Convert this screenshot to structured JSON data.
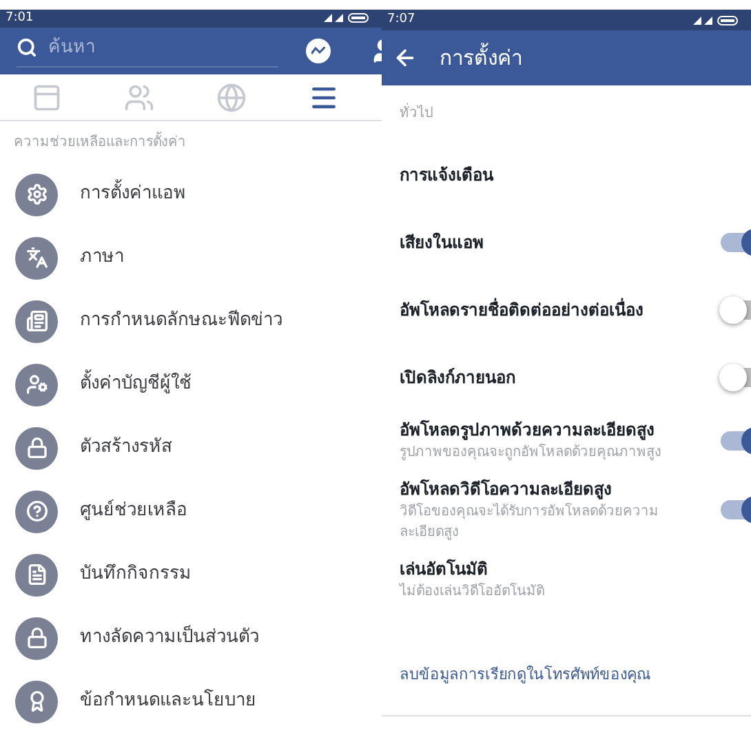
{
  "left_screen": {
    "status_bar": {
      "time": "7:01"
    },
    "search": {
      "placeholder": "ค้นหา"
    },
    "tabs": [
      {
        "selected": false
      },
      {
        "selected": false
      },
      {
        "selected": false
      },
      {
        "selected": true
      }
    ],
    "section": "ความช่วยเหลือและการตั้งค่า",
    "items": [
      {
        "label": "การตั้งค่าแอพ"
      },
      {
        "label": "ภาษา"
      },
      {
        "label": "การกำหนดลักษณะฟีดข่าว"
      },
      {
        "label": "ตั้งค่าบัญชีผู้ใช้"
      },
      {
        "label": "ตัวสร้างรหัส"
      },
      {
        "label": "ศูนย์ช่วยเหลือ"
      },
      {
        "label": "บันทึกกิจกรรม"
      },
      {
        "label": "ทางลัดความเป็นส่วนตัว"
      },
      {
        "label": "ข้อกำหนดและนโยบาย"
      }
    ]
  },
  "right_screen": {
    "status_bar": {
      "time": "7:07"
    },
    "title": "การตั้งค่า",
    "section": "ทั่วไป",
    "rows": [
      {
        "kind": "plain",
        "title": "การแจ้งเตือน"
      },
      {
        "kind": "toggle",
        "title": "เสียงในแอพ",
        "on": true
      },
      {
        "kind": "toggle",
        "title": "อัพโหลดรายชื่อติดต่ออย่างต่อเนื่อง",
        "on": false
      },
      {
        "kind": "toggle",
        "title": "เปิดลิงก์ภายนอก",
        "on": false
      },
      {
        "kind": "toggle",
        "title": "อัพโหลดรูปภาพด้วยความละเอียดสูง",
        "subtitle": "รูปภาพของคุณจะถูกอัพโหลดด้วยคุณภาพสูง",
        "on": true
      },
      {
        "kind": "toggle",
        "title": "อัพโหลดวิดีโอความละเอียดสูง",
        "subtitle": "วิดีโอของคุณจะได้รับการอัพโหลดด้วยความละเอียดสูง",
        "on": true
      },
      {
        "kind": "plain",
        "title": "เล่นอัตโนมัติ",
        "subtitle": "ไม่ต้องเล่นวิดีโออัตโนมัติ"
      },
      {
        "kind": "link",
        "title": "ลบข้อมูลการเรียกดูในโทรศัพท์ของคุณ"
      }
    ]
  }
}
